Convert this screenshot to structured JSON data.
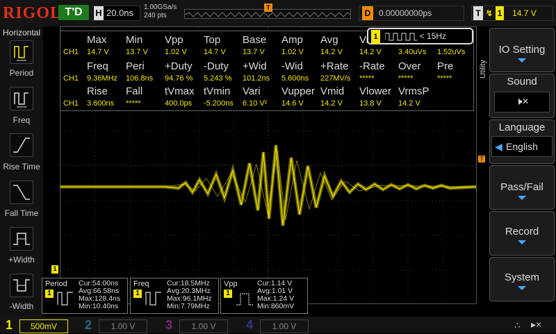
{
  "brand": {
    "logo": "RIGOL"
  },
  "status": {
    "run_state": "T'D"
  },
  "timebase": {
    "label": "H",
    "value": "20.0ns"
  },
  "acquisition": {
    "sample_rate": "1.00GSa/s",
    "points": "240 pts"
  },
  "trigger_position": {
    "label": "T"
  },
  "delay": {
    "label": "D",
    "value": "0.00000000ps"
  },
  "trigger": {
    "label": "T",
    "source": "1",
    "level": "14.7 V"
  },
  "horizontal_menu": {
    "title": "Horizontal",
    "items": [
      {
        "label": "Period"
      },
      {
        "label": "Freq"
      },
      {
        "label": "Rise Time"
      },
      {
        "label": "Fall Time"
      },
      {
        "label": "+Width"
      },
      {
        "label": "-Width"
      }
    ]
  },
  "pulse_trigger_box": {
    "channel": "1",
    "condition": "< 15Hz"
  },
  "measurements": {
    "channel_label": "CH1",
    "row1": {
      "headers": [
        "Max",
        "Min",
        "Vpp",
        "Top",
        "Base",
        "Amp",
        "Avg",
        "Vr",
        "",
        ""
      ],
      "values": [
        "14.7 V",
        "13.7 V",
        "1.02 V",
        "14.7 V",
        "13.7 V",
        "1.02 V",
        "14.2 V",
        "14.2 V",
        "3.40uVs",
        "1.52uVs"
      ]
    },
    "row2": {
      "headers": [
        "Freq",
        "Peri",
        "+Duty",
        "-Duty",
        "+Wid",
        "-Wid",
        "+Rate",
        "-Rate",
        "Over",
        "Pre"
      ],
      "values": [
        "9.36MHz",
        "106.8ns",
        "94.76 %",
        "5.243 %",
        "101.2ns",
        "5.600ns",
        "227MV/s",
        "*****",
        "*****",
        "*****"
      ]
    },
    "row3": {
      "headers": [
        "Rise",
        "Fall",
        "tVmax",
        "tVmin",
        "Vari",
        "Vupper",
        "Vmid",
        "Vlower",
        "VrmsP"
      ],
      "values": [
        "3.600ns",
        "*****",
        "400.0ps",
        "-5.200ns",
        "6.10 V²",
        "14.6 V",
        "14.2 V",
        "13.8 V",
        "14.2 V"
      ]
    }
  },
  "right_menu": {
    "utility_label": "Utility",
    "items": [
      {
        "label": "IO Setting"
      },
      {
        "label": "Sound"
      },
      {
        "label": "Language",
        "value": "English"
      },
      {
        "label": "Pass/Fail"
      },
      {
        "label": "Record"
      },
      {
        "label": "System"
      }
    ]
  },
  "stats": [
    {
      "title": "Period",
      "channel": "1",
      "cur": "Cur:54.00ns",
      "avg": "Avg:66.58ns",
      "max": "Max:128.4ns",
      "min": "Min:10.40ns"
    },
    {
      "title": "Freq",
      "channel": "1",
      "cur": "Cur:18.5MHz",
      "avg": "Avg:20.3MHz",
      "max": "Max:96.1MHz",
      "min": "Min:7.79MHz"
    },
    {
      "title": "Vpp",
      "channel": "1",
      "cur": "Cur:1.14 V",
      "avg": "Avg:1.01 V",
      "max": "Max:1.24 V",
      "min": "Min:860mV"
    }
  ],
  "channels": [
    {
      "num": "1",
      "scale": "500mV",
      "color": "#f3e600"
    },
    {
      "num": "2",
      "scale": "1.00 V",
      "color": "#00c8ff"
    },
    {
      "num": "3",
      "scale": "1.00 V",
      "color": "#e040e0"
    },
    {
      "num": "4",
      "scale": "1.00 V",
      "color": "#2060ff"
    }
  ],
  "colors": {
    "ch1": "#f3e600",
    "accent": "#f08c00",
    "brand": "#e0301e"
  }
}
